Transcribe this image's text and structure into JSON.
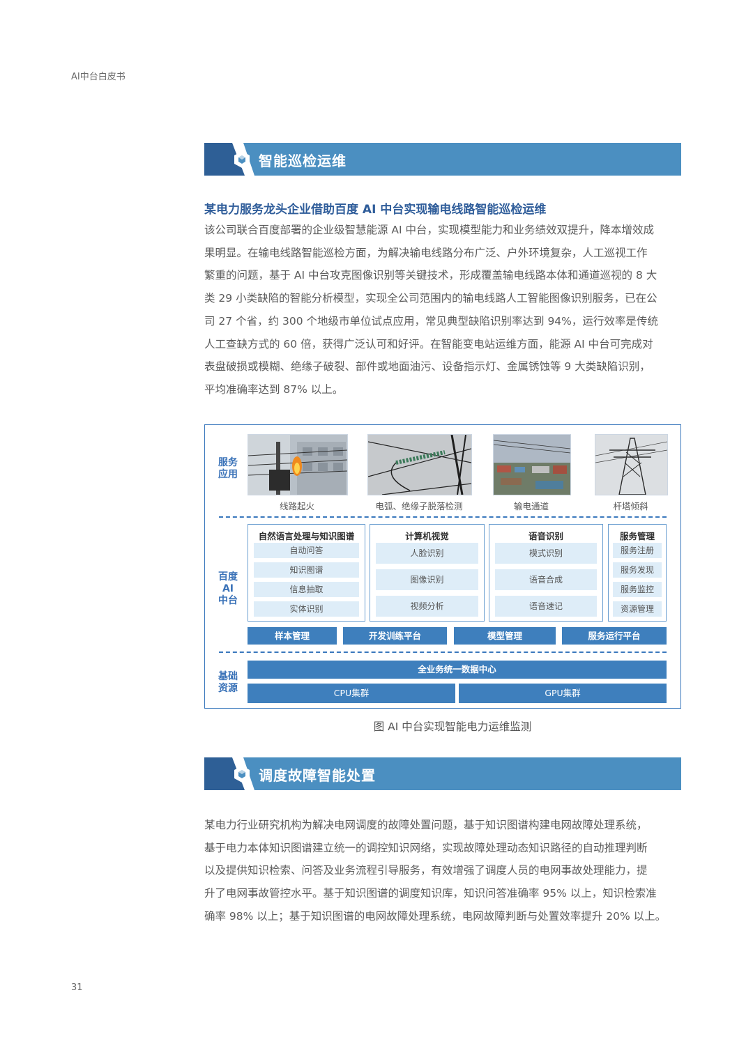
{
  "header": {
    "label": "AI中台白皮书"
  },
  "section1": {
    "title": "智能巡检运维"
  },
  "case1": {
    "heading": "某电力服务龙头企业借助百度 AI 中台实现输电线路智能巡检运维",
    "lines": [
      "该公司联合百度部署的企业级智慧能源 AI 中台，实现模型能力和业务绩效双提升，降本增效成",
      "果明显。在输电线路智能巡检方面，为解决输电线路分布广泛、户外环境复杂，人工巡视工作",
      "繁重的问题，基于 AI 中台攻克图像识别等关键技术，形成覆盖输电线路本体和通道巡视的 8 大",
      "类 29 小类缺陷的智能分析模型，实现全公司范围内的输电线路人工智能图像识别服务，已在公",
      "司 27 个省，约 300 个地级市单位试点应用，常见典型缺陷识别率达到 94%，运行效率是传统",
      "人工查缺方式的 60 倍，获得广泛认可和好评。在智能变电站运维方面，能源 AI 中台可完成对",
      "表盘破损或模糊、绝缘子破裂、部件或地面油污、设备指示灯、金属锈蚀等 9 大类缺陷识别，",
      "平均准确率达到 87% 以上。"
    ]
  },
  "diagram": {
    "label_service": "服务\n应用",
    "label_ai": "百度\nAI\n中台",
    "label_base": "基础\n资源",
    "photos": [
      {
        "caption": "线路起火"
      },
      {
        "caption": "电弧、绝缘子脱落检测"
      },
      {
        "caption": "输电通道"
      },
      {
        "caption": "杆塔倾斜"
      }
    ],
    "panels": [
      {
        "title": "自然语言处理与知识图谱",
        "items": [
          "自动问答",
          "知识图谱",
          "信息抽取",
          "实体识别"
        ]
      },
      {
        "title": "计算机视觉",
        "items": [
          "人脸识别",
          "图像识别",
          "视频分析"
        ]
      },
      {
        "title": "语音识别",
        "items": [
          "模式识别",
          "语音合成",
          "语音速记"
        ]
      },
      {
        "title": "服务管理",
        "items": [
          "服务注册",
          "服务发现",
          "服务监控",
          "资源管理"
        ]
      }
    ],
    "platform_bars": [
      "样本管理",
      "开发训练平台",
      "模型管理",
      "服务运行平台"
    ],
    "data_center": "全业务统一数据中心",
    "clusters": [
      "CPU集群",
      "GPU集群"
    ],
    "colors": {
      "accent": "#3e7fbd",
      "chip": "#deedf8",
      "banner": "#4b8fc1"
    }
  },
  "figure": {
    "caption": "图  AI 中台实现智能电力运维监测"
  },
  "section2": {
    "title": "调度故障智能处置"
  },
  "case2": {
    "lines": [
      "某电力行业研究机构为解决电网调度的故障处置问题，基于知识图谱构建电网故障处理系统，",
      "基于电力本体知识图谱建立统一的调控知识网络，实现故障处理动态知识路径的自动推理判断",
      "以及提供知识检索、问答及业务流程引导服务，有效增强了调度人员的电网事故处理能力，提",
      "升了电网事故管控水平。基于知识图谱的调度知识库，知识问答准确率 95% 以上，知识检索准",
      "确率 98% 以上；基于知识图谱的电网故障处理系统，电网故障判断与处置效率提升 20% 以上。"
    ]
  },
  "footer": {
    "page_number": "31"
  }
}
